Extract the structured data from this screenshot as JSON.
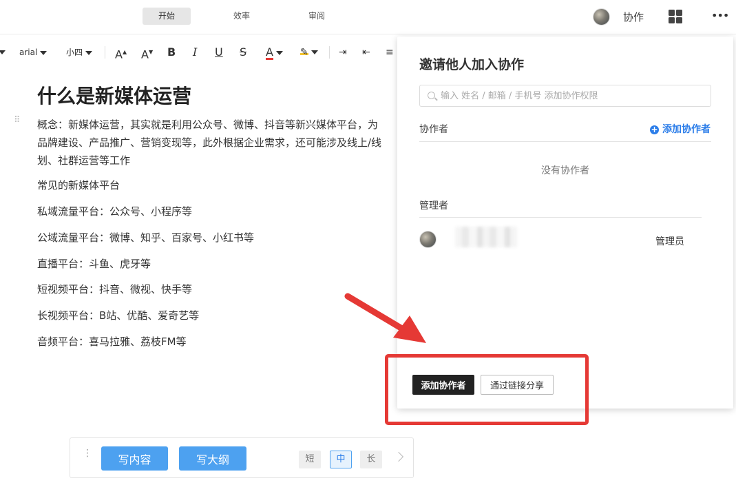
{
  "header": {
    "tabs": [
      {
        "label": "开始",
        "active": true
      },
      {
        "label": "效率",
        "active": false
      },
      {
        "label": "审阅",
        "active": false
      }
    ],
    "collab_label": "协作",
    "grid_icon": "grid-icon",
    "more_label": "•••"
  },
  "toolbar": {
    "font_name": "arial",
    "font_size": "小四",
    "increase_font": "A",
    "decrease_font": "A",
    "bold": "B",
    "italic": "I",
    "underline": "U",
    "strikethrough": "S",
    "font_color": "A",
    "font_color_value": "#e53935",
    "highlight_color_value": "#f4c430"
  },
  "document": {
    "title": "什么是新媒体运营",
    "paragraphs": [
      {
        "lines": [
          "概念：新媒体运营，其实就是利用公众号、微博、抖音等新兴媒体平台，为",
          "品牌建设、产品推广、营销变现等，此外根据企业需求，还可能涉及线上/线",
          "划、社群运营等工作"
        ]
      },
      {
        "lines": [
          "常见的新媒体平台"
        ]
      },
      {
        "lines": [
          "私域流量平台：公众号、小程序等"
        ]
      },
      {
        "lines": [
          "公域流量平台：微博、知乎、百家号、小红书等"
        ]
      },
      {
        "lines": [
          "直播平台：斗鱼、虎牙等"
        ]
      },
      {
        "lines": [
          "短视频平台：抖音、微视、快手等"
        ]
      },
      {
        "lines": [
          "长视频平台：B站、优酷、爱奇艺等"
        ]
      },
      {
        "lines": [
          "音频平台：喜马拉雅、荔枝FM等"
        ]
      }
    ]
  },
  "panel": {
    "title": "邀请他人加入协作",
    "search_placeholder": "输入 姓名 / 邮箱 / 手机号 添加协作权限",
    "collaborators_label": "协作者",
    "add_collaborator_link": "添加协作者",
    "empty_text": "没有协作者",
    "admins_label": "管理者",
    "admin_role": "管理员",
    "add_button": "添加协作者",
    "share_link_button": "通过链接分享"
  },
  "annotation": {
    "color": "#e53935"
  },
  "writebar": {
    "write_content": "写内容",
    "write_outline": "写大纲",
    "length_options": [
      {
        "label": "短",
        "active": false
      },
      {
        "label": "中",
        "active": true
      },
      {
        "label": "长",
        "active": false
      }
    ]
  }
}
